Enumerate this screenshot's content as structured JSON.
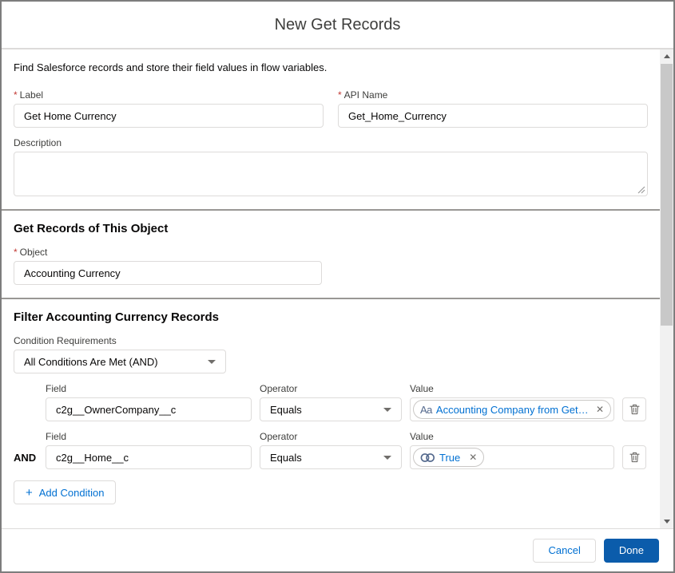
{
  "modal": {
    "title": "New Get Records",
    "intro": "Find Salesforce records and store their field values in flow variables."
  },
  "fields": {
    "label": {
      "required": "*",
      "label": "Label",
      "value": "Get Home Currency"
    },
    "api_name": {
      "required": "*",
      "label": "API Name",
      "value": "Get_Home_Currency"
    },
    "description": {
      "label": "Description",
      "value": ""
    }
  },
  "object_section": {
    "heading": "Get Records of This Object",
    "object": {
      "required": "*",
      "label": "Object",
      "value": "Accounting Currency"
    }
  },
  "filter_section": {
    "heading": "Filter Accounting Currency Records",
    "condition_requirements_label": "Condition Requirements",
    "condition_requirements_value": "All Conditions Are Met (AND)",
    "rows": [
      {
        "field_label": "Field",
        "field_value": "c2g__OwnerCompany__c",
        "operator_label": "Operator",
        "operator_value": "Equals",
        "value_label": "Value",
        "pill_text": "Accounting Company from Get_...",
        "pill_icon": "text-type"
      },
      {
        "joiner": "AND",
        "field_label": "Field",
        "field_value": "c2g__Home__c",
        "operator_label": "Operator",
        "operator_value": "Equals",
        "value_label": "Value",
        "pill_text": "True",
        "pill_icon": "boolean-toggle"
      }
    ],
    "add_condition_label": "Add Condition"
  },
  "footer": {
    "cancel_label": "Cancel",
    "done_label": "Done"
  },
  "icons": {
    "close_x": "✕",
    "add_plus": "+",
    "text_type": "Aa"
  },
  "colors": {
    "brand_button": "#0b5cab",
    "link": "#0070d2",
    "border": "#dddbda",
    "section_divider": "#999795",
    "label_text": "#3e3e3c",
    "heading_text": "#080707",
    "required_mark": "#c23934",
    "icon_gray": "#706e6b",
    "type_icon": "#54698d"
  }
}
